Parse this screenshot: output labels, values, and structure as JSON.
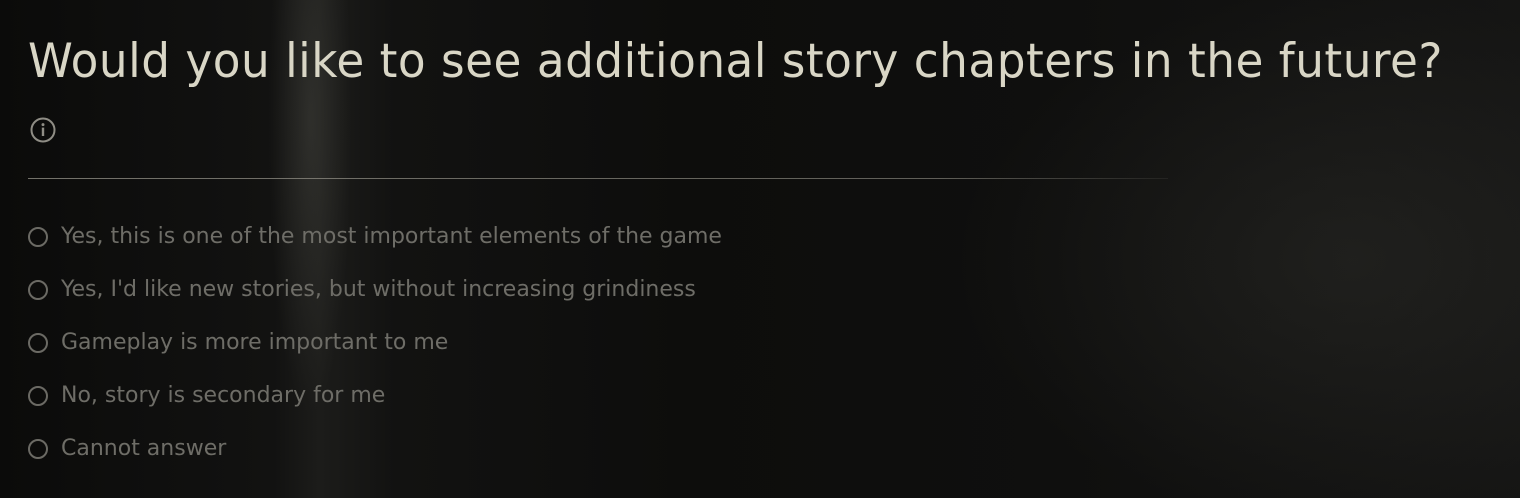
{
  "survey": {
    "question": "Would you like to see additional story chapters in the future?",
    "info_icon": "info-circle-icon",
    "options": [
      {
        "label": "Yes, this is one of the most important elements of the game",
        "selected": false
      },
      {
        "label": "Yes, I'd like new stories, but without increasing grindiness",
        "selected": false
      },
      {
        "label": "Gameplay is more important to me",
        "selected": false
      },
      {
        "label": "No, story is secondary for me",
        "selected": false
      },
      {
        "label": "Cannot answer",
        "selected": false
      }
    ]
  },
  "colors": {
    "title": "#d9d6c6",
    "option_text": "#6e6d67",
    "radio_border": "#6b6a64",
    "divider": "#96948a"
  }
}
